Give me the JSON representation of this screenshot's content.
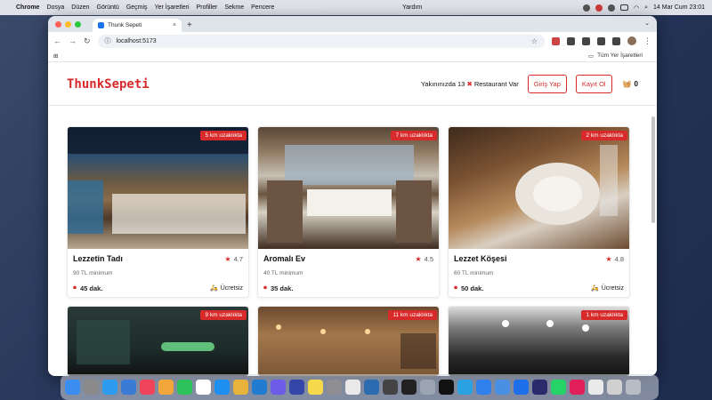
{
  "menubar": {
    "app": "Chrome",
    "items": [
      "Dosya",
      "Düzen",
      "Görüntü",
      "Geçmiş",
      "Yer İşaretleri",
      "Profiller",
      "Sekme",
      "Pencere"
    ],
    "help": "Yardım",
    "clock": "14 Mar Cum  23:01"
  },
  "browser": {
    "tab_title": "Thunk Sepeti",
    "url": "localhost:5173",
    "bookmarks_folder": "Tüm Yer İşaretleri"
  },
  "header": {
    "logo": "ThunkSepeti",
    "nearby_prefix": "Yakınınızda",
    "nearby_count": "13",
    "nearby_suffix": "Restaurant Var",
    "login_button": "Giriş Yap",
    "register_button": "Kayıt Ol",
    "basket_count": "0"
  },
  "restaurants": [
    {
      "name": "Lezzetin Tadı",
      "distance": "5 km uzaklıkta",
      "rating": "4.7",
      "min_order": "90 TL minimum",
      "time": "45 dak.",
      "delivery": "Ücretsiz"
    },
    {
      "name": "Aromalı Ev",
      "distance": "7 km uzaklıkta",
      "rating": "4.5",
      "min_order": "40 TL minimum",
      "time": "35 dak.",
      "delivery": ""
    },
    {
      "name": "Lezzet Köşesi",
      "distance": "2 km uzaklıkta",
      "rating": "4.8",
      "min_order": "60 TL minimum",
      "time": "50 dak.",
      "delivery": "Ücretsiz"
    },
    {
      "name": "",
      "distance": "9 km uzaklıkta"
    },
    {
      "name": "",
      "distance": "11 km uzaklıkta"
    },
    {
      "name": "",
      "distance": "1 km uzaklıkta"
    }
  ],
  "icons": {
    "star": "star-icon",
    "clock": "clock-icon",
    "delivery": "delivery-bike-icon",
    "basket": "basket-icon",
    "close_x": "close-x-icon"
  },
  "colors": {
    "brand": "#d82a2a"
  }
}
